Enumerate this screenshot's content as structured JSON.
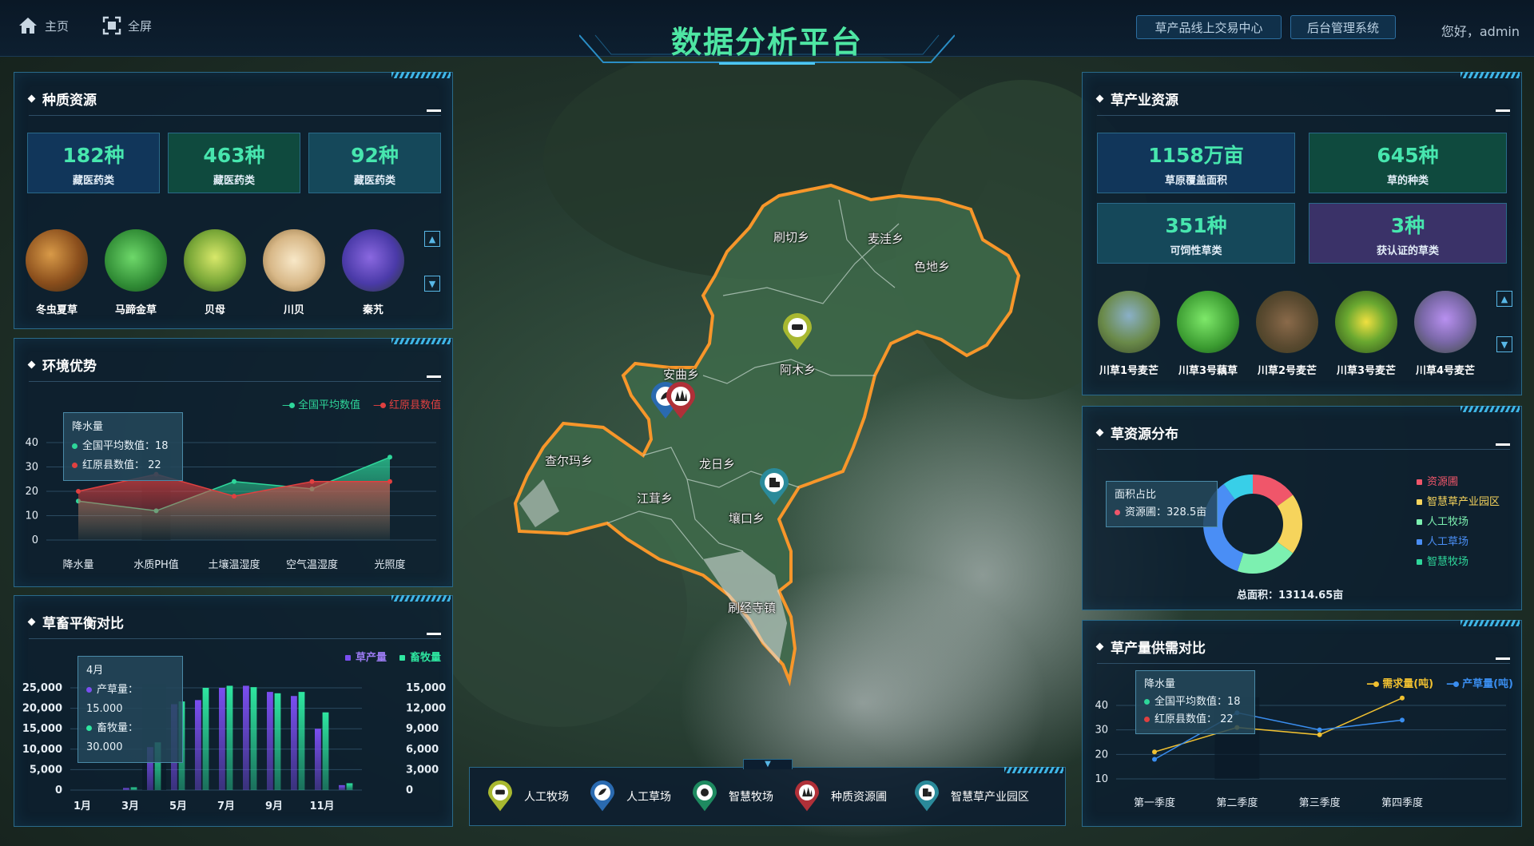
{
  "topbar": {
    "home": "主页",
    "fullscreen": "全屏",
    "title": "数据分析平台",
    "btn_market": "草产品线上交易中心",
    "btn_admin": "后台管理系统",
    "user": "您好，admin"
  },
  "germplasm": {
    "title": "种质资源",
    "stats": [
      {
        "value": "182种",
        "label": "藏医药类"
      },
      {
        "value": "463种",
        "label": "藏医药类"
      },
      {
        "value": "92种",
        "label": "藏医药类"
      }
    ],
    "items": [
      "冬虫夏草",
      "马蹄金草",
      "贝母",
      "川贝",
      "秦艽"
    ]
  },
  "environment": {
    "title": "环境优势",
    "legend": [
      "全国平均数值",
      "红原县数值"
    ],
    "tooltip": {
      "title": "降水量",
      "row1": "全国平均数值：18",
      "row2": "红原县数值：  22"
    }
  },
  "balance": {
    "title": "草畜平衡对比",
    "legend": [
      "草产量",
      "畜牧量"
    ],
    "tooltip": {
      "title": "4月",
      "row1": "产草量：15.000",
      "row2": "畜牧量：30.000"
    }
  },
  "industry": {
    "title": "草产业资源",
    "stats": [
      {
        "value": "1158万亩",
        "label": "草原覆盖面积"
      },
      {
        "value": "645种",
        "label": "草的种类"
      },
      {
        "value": "351种",
        "label": "可饲性草类"
      },
      {
        "value": "3种",
        "label": "获认证的草类"
      }
    ],
    "items": [
      "川草1号麦芒",
      "川草3号藕草",
      "川草2号麦芒",
      "川草3号麦芒",
      "川草4号麦芒"
    ]
  },
  "distribution": {
    "title": "草资源分布",
    "tooltip_title": "面积占比",
    "tooltip_row": "资源圃：328.5亩",
    "total": "总面积：13114.65亩",
    "legend": [
      {
        "name": "资源圃",
        "color": "#f0566a"
      },
      {
        "name": "智慧草产业园区",
        "color": "#f6d45c"
      },
      {
        "name": "人工牧场",
        "color": "#7cf0b0"
      },
      {
        "name": "人工草场",
        "color": "#4a8ef5"
      },
      {
        "name": "智慧牧场",
        "color": "#2ed69a"
      }
    ]
  },
  "supply": {
    "title": "草产量供需对比",
    "legend": [
      "需求量(吨)",
      "产草量(吨)"
    ],
    "tooltip": {
      "title": "降水量",
      "row1": "全国平均数值：18",
      "row2": "红原县数值：  22"
    }
  },
  "map": {
    "towns": [
      "刷切乡",
      "麦洼乡",
      "色地乡",
      "安曲乡",
      "阿木乡",
      "查尔玛乡",
      "龙日乡",
      "江茸乡",
      "壤口乡",
      "刷经寺镇"
    ],
    "legend": [
      "人工牧场",
      "人工草场",
      "智慧牧场",
      "种质资源圃",
      "智慧草产业园区"
    ]
  },
  "chart_data": [
    {
      "type": "area",
      "categories": [
        "降水量",
        "水质PH值",
        "土壤温湿度",
        "空气温湿度",
        "光照度"
      ],
      "series": [
        {
          "name": "全国平均数值",
          "values": [
            16,
            12,
            24,
            21,
            34
          ],
          "color": "#2ed69a"
        },
        {
          "name": "红原县数值",
          "values": [
            20,
            27,
            18,
            24,
            24
          ],
          "color": "#e04040"
        }
      ],
      "ylim": [
        0,
        40
      ],
      "yticks": [
        0,
        10,
        20,
        30,
        40
      ]
    },
    {
      "type": "bar",
      "categories": [
        "1月",
        "2月",
        "3月",
        "4月",
        "5月",
        "6月",
        "7月",
        "8月",
        "9月",
        "10月",
        "11月",
        "12月"
      ],
      "xtick_labels": [
        "1月",
        "3月",
        "5月",
        "7月",
        "9月",
        "11月"
      ],
      "series": [
        {
          "name": "草产量",
          "values": [
            0,
            0,
            500,
            10500,
            21000,
            22000,
            25000,
            25500,
            24000,
            23000,
            15000,
            1200
          ],
          "color": "#7a4ef0",
          "axis": "left"
        },
        {
          "name": "畜牧量",
          "values": [
            0,
            0,
            400,
            7000,
            13000,
            15000,
            15300,
            15100,
            14200,
            14400,
            11400,
            1000
          ],
          "color": "#2ee6a0",
          "axis": "right"
        }
      ],
      "ylim_left": [
        0,
        25000
      ],
      "yticks_left": [
        "0",
        "5,000",
        "10,000",
        "15,000",
        "20,000",
        "25,000"
      ],
      "ylim_right": [
        0,
        15000
      ],
      "yticks_right": [
        "0",
        "3,000",
        "6,000",
        "9,000",
        "12,000",
        "15,000"
      ]
    },
    {
      "type": "pie",
      "slices": [
        {
          "name": "资源圃",
          "value": 15,
          "color": "#f0566a"
        },
        {
          "name": "智慧草产业园区",
          "value": 20,
          "color": "#f6d45c"
        },
        {
          "name": "人工牧场",
          "value": 20,
          "color": "#7cf0b0"
        },
        {
          "name": "人工草场",
          "value": 35,
          "color": "#4a8ef5"
        },
        {
          "name": "智慧牧场",
          "value": 10,
          "color": "#38cfe8"
        }
      ]
    },
    {
      "type": "line",
      "categories": [
        "第一季度",
        "第二季度",
        "第三季度",
        "第四季度"
      ],
      "series": [
        {
          "name": "需求量(吨)",
          "values": [
            21,
            31,
            28,
            43
          ],
          "color": "#f0c030"
        },
        {
          "name": "产草量(吨)",
          "values": [
            18,
            37,
            30,
            34
          ],
          "color": "#3a8ef0"
        }
      ],
      "ylim": [
        10,
        40
      ],
      "yticks": [
        10,
        20,
        30,
        40
      ]
    }
  ]
}
